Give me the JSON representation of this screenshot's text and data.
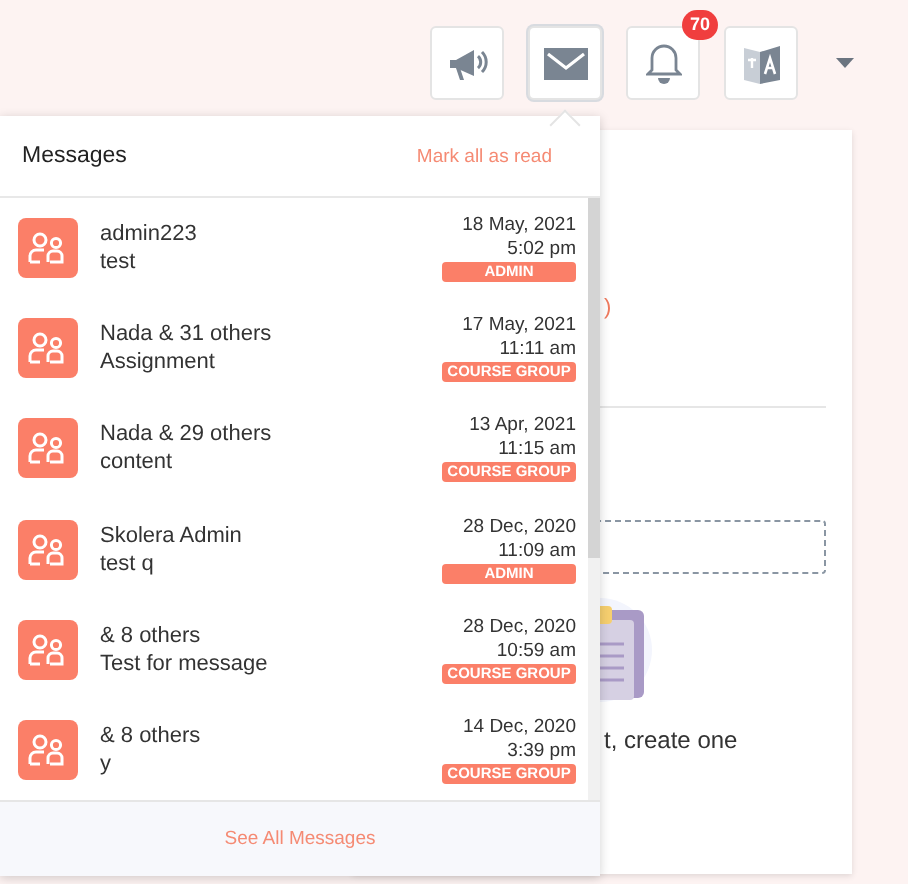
{
  "toolbar": [
    {
      "kind": "megaphone",
      "selected": false
    },
    {
      "kind": "mail",
      "selected": true
    },
    {
      "kind": "bell",
      "selected": false,
      "badge": "70"
    },
    {
      "kind": "translate",
      "selected": false
    }
  ],
  "background_card": {
    "fragment": ")",
    "empty_text": "t, create one"
  },
  "messages": {
    "title": "Messages",
    "mark_all": "Mark all as read",
    "items": [
      {
        "sender": "admin223",
        "subject": "test",
        "date": "18 May, 2021",
        "time": "5:02 pm",
        "tag": "ADMIN"
      },
      {
        "sender": "Nada & 31 others",
        "subject": "Assignment",
        "date": "17 May, 2021",
        "time": "11:11 am",
        "tag": "COURSE GROUP"
      },
      {
        "sender": "Nada & 29 others",
        "subject": "content",
        "date": "13 Apr, 2021",
        "time": "11:15 am",
        "tag": "COURSE GROUP"
      },
      {
        "sender": "Skolera Admin",
        "subject": "test q",
        "date": "28 Dec, 2020",
        "time": "11:09 am",
        "tag": "ADMIN"
      },
      {
        "sender": "& 8 others",
        "subject": "Test for message",
        "date": "28 Dec, 2020",
        "time": "10:59 am",
        "tag": "COURSE GROUP"
      },
      {
        "sender": "& 8 others",
        "subject": "y",
        "date": "14 Dec, 2020",
        "time": "3:39 pm",
        "tag": "COURSE GROUP"
      }
    ],
    "footer": "See All Messages"
  }
}
